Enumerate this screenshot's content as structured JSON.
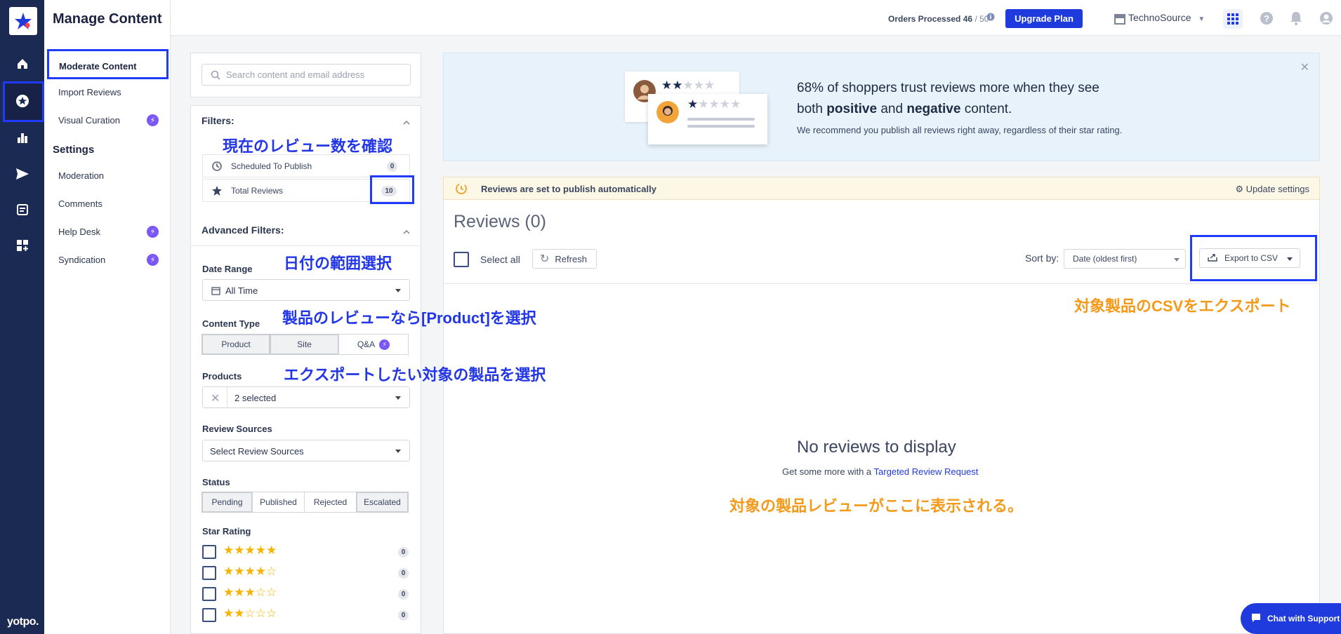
{
  "brand": {
    "name": "yotpo."
  },
  "nav": {
    "title": "Manage Content",
    "items": [
      {
        "label": "Moderate Content"
      },
      {
        "label": "Import Reviews"
      },
      {
        "label": "Visual Curation"
      }
    ],
    "settings_heading": "Settings",
    "settings_items": [
      {
        "label": "Moderation"
      },
      {
        "label": "Comments"
      },
      {
        "label": "Help Desk"
      },
      {
        "label": "Syndication"
      }
    ]
  },
  "topbar": {
    "orders_label": "Orders Processed",
    "orders_count": "46",
    "orders_limit": "/ 50",
    "upgrade_label": "Upgrade Plan",
    "store_name": "TechnoSource"
  },
  "filters": {
    "search_placeholder": "Search content and email address",
    "heading": "Filters:",
    "scheduled_label": "Scheduled To Publish",
    "scheduled_count": "0",
    "total_label": "Total Reviews",
    "total_count": "10",
    "advanced_heading": "Advanced Filters:",
    "date_range_label": "Date Range",
    "date_range_value": "All Time",
    "content_type_label": "Content Type",
    "content_types": [
      "Product",
      "Site",
      "Q&A"
    ],
    "products_label": "Products",
    "products_value": "2 selected",
    "sources_label": "Review Sources",
    "sources_value": "Select Review Sources",
    "status_label": "Status",
    "statuses": [
      "Pending",
      "Published",
      "Rejected",
      "Escalated"
    ],
    "star_rating_label": "Star Rating",
    "star_rows": [
      {
        "stars": "★★★★★",
        "count": "0"
      },
      {
        "stars": "★★★★☆",
        "count": "0"
      },
      {
        "stars": "★★★☆☆",
        "count": "0"
      },
      {
        "stars": "★★☆☆☆",
        "count": "0"
      }
    ]
  },
  "banner": {
    "headline_pre": "68% of shoppers trust reviews more when they see both ",
    "headline_b1": "positive",
    "headline_mid": " and ",
    "headline_b2": "negative",
    "headline_post": " content.",
    "sub": "We recommend you publish all reviews right away, regardless of their star rating."
  },
  "autopublish": {
    "message": "Reviews are set to publish automatically",
    "update_label": "Update settings"
  },
  "reviews": {
    "title": "Reviews (0)",
    "select_all": "Select all",
    "refresh": "Refresh",
    "sort_label": "Sort by:",
    "sort_value": "Date (oldest first)",
    "export_label": "Export to CSV",
    "empty_title": "No reviews to display",
    "empty_sub": "Get some more with a ",
    "empty_link": "Targeted Review Request"
  },
  "annotations": {
    "check_count": "現在のレビュー数を確認",
    "date_range": "日付の範囲選択",
    "product_type": "製品のレビューなら[Product]を選択",
    "select_product": "エクスポートしたい対象の製品を選択",
    "export_csv": "対象製品のCSVをエクスポート",
    "shown_here": "対象の製品レビューがここに表示される。"
  },
  "chat": {
    "label": "Chat with Support"
  },
  "colors": {
    "accent": "#1f3bdd",
    "annotation_blue": "#2236e8",
    "annotation_orange": "#f39a1b",
    "star": "#f5b400"
  }
}
